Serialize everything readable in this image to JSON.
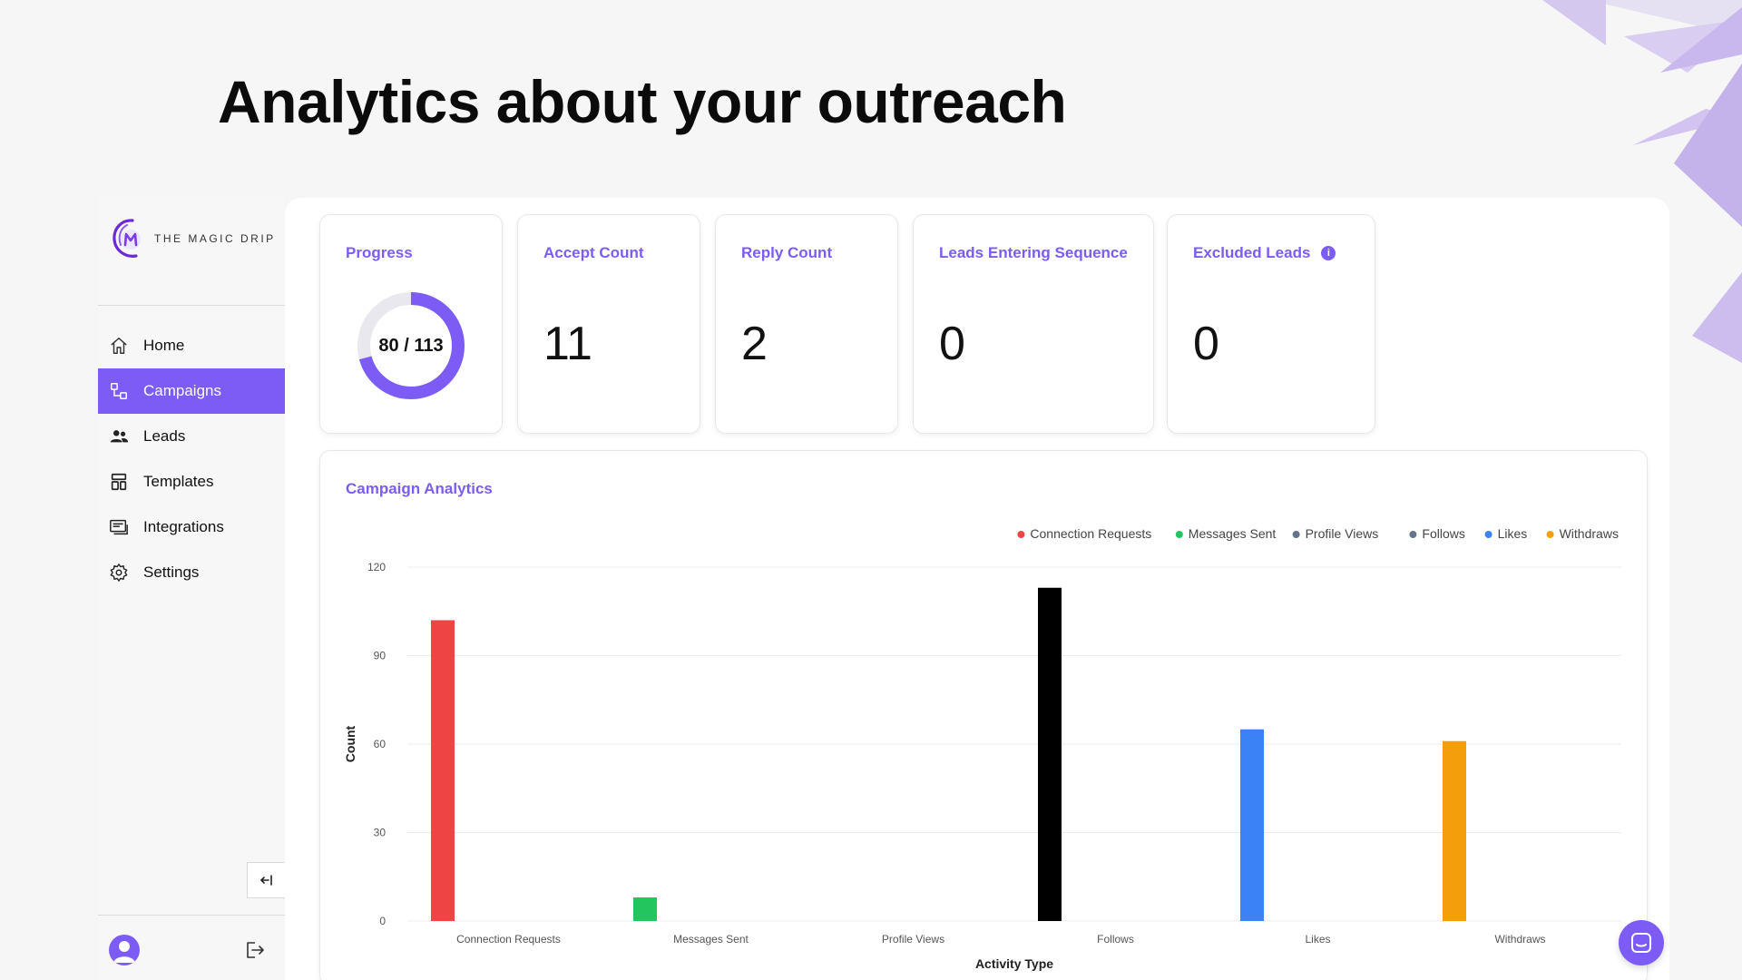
{
  "headline": "Analytics about your outreach",
  "brand": {
    "name": "THE MAGIC DRIP",
    "accent": "#7c5cf5"
  },
  "sidebar": {
    "items": [
      {
        "label": "Home",
        "icon": "home-icon",
        "active": false
      },
      {
        "label": "Campaigns",
        "icon": "campaigns-icon",
        "active": true
      },
      {
        "label": "Leads",
        "icon": "users-icon",
        "active": false
      },
      {
        "label": "Templates",
        "icon": "templates-icon",
        "active": false
      },
      {
        "label": "Integrations",
        "icon": "integrations-icon",
        "active": false
      },
      {
        "label": "Settings",
        "icon": "gear-icon",
        "active": false
      }
    ],
    "collapse_icon": "collapse-left-icon",
    "avatar_icon": "user-avatar-icon",
    "logout_icon": "logout-icon"
  },
  "stats": {
    "progress": {
      "title": "Progress",
      "value": "80 / 113",
      "done": 80,
      "total": 113
    },
    "accept": {
      "title": "Accept Count",
      "value": "11"
    },
    "reply": {
      "title": "Reply Count",
      "value": "2"
    },
    "leads_entering": {
      "title": "Leads Entering Sequence",
      "value": "0"
    },
    "excluded": {
      "title": "Excluded Leads",
      "value": "0",
      "info_icon": "info-icon"
    }
  },
  "campaign_analytics": {
    "title": "Campaign Analytics"
  },
  "chart_data": {
    "type": "bar",
    "categories": [
      "Connection Requests",
      "Messages Sent",
      "Profile Views",
      "Follows",
      "Likes",
      "Withdraws"
    ],
    "values": [
      102,
      8,
      0,
      113,
      65,
      61
    ],
    "colors": [
      "#ef4444",
      "#22c55e",
      "#64748b",
      "#000000",
      "#3b82f6",
      "#f59e0b"
    ],
    "legend": [
      "Connection Requests",
      "Messages Sent",
      "Profile Views",
      "Follows",
      "Likes",
      "Withdraws"
    ],
    "legend_colors": [
      "#ef4444",
      "#22c55e",
      "#64748b",
      "#64748b",
      "#3b82f6",
      "#f59e0b"
    ],
    "legend_position": "top-right",
    "xlabel": "Activity Type",
    "ylabel": "Count",
    "ylim": [
      0,
      120
    ],
    "yticks": [
      0,
      30,
      60,
      90,
      120
    ],
    "grid": true
  },
  "chat_icon": "chat-icon"
}
